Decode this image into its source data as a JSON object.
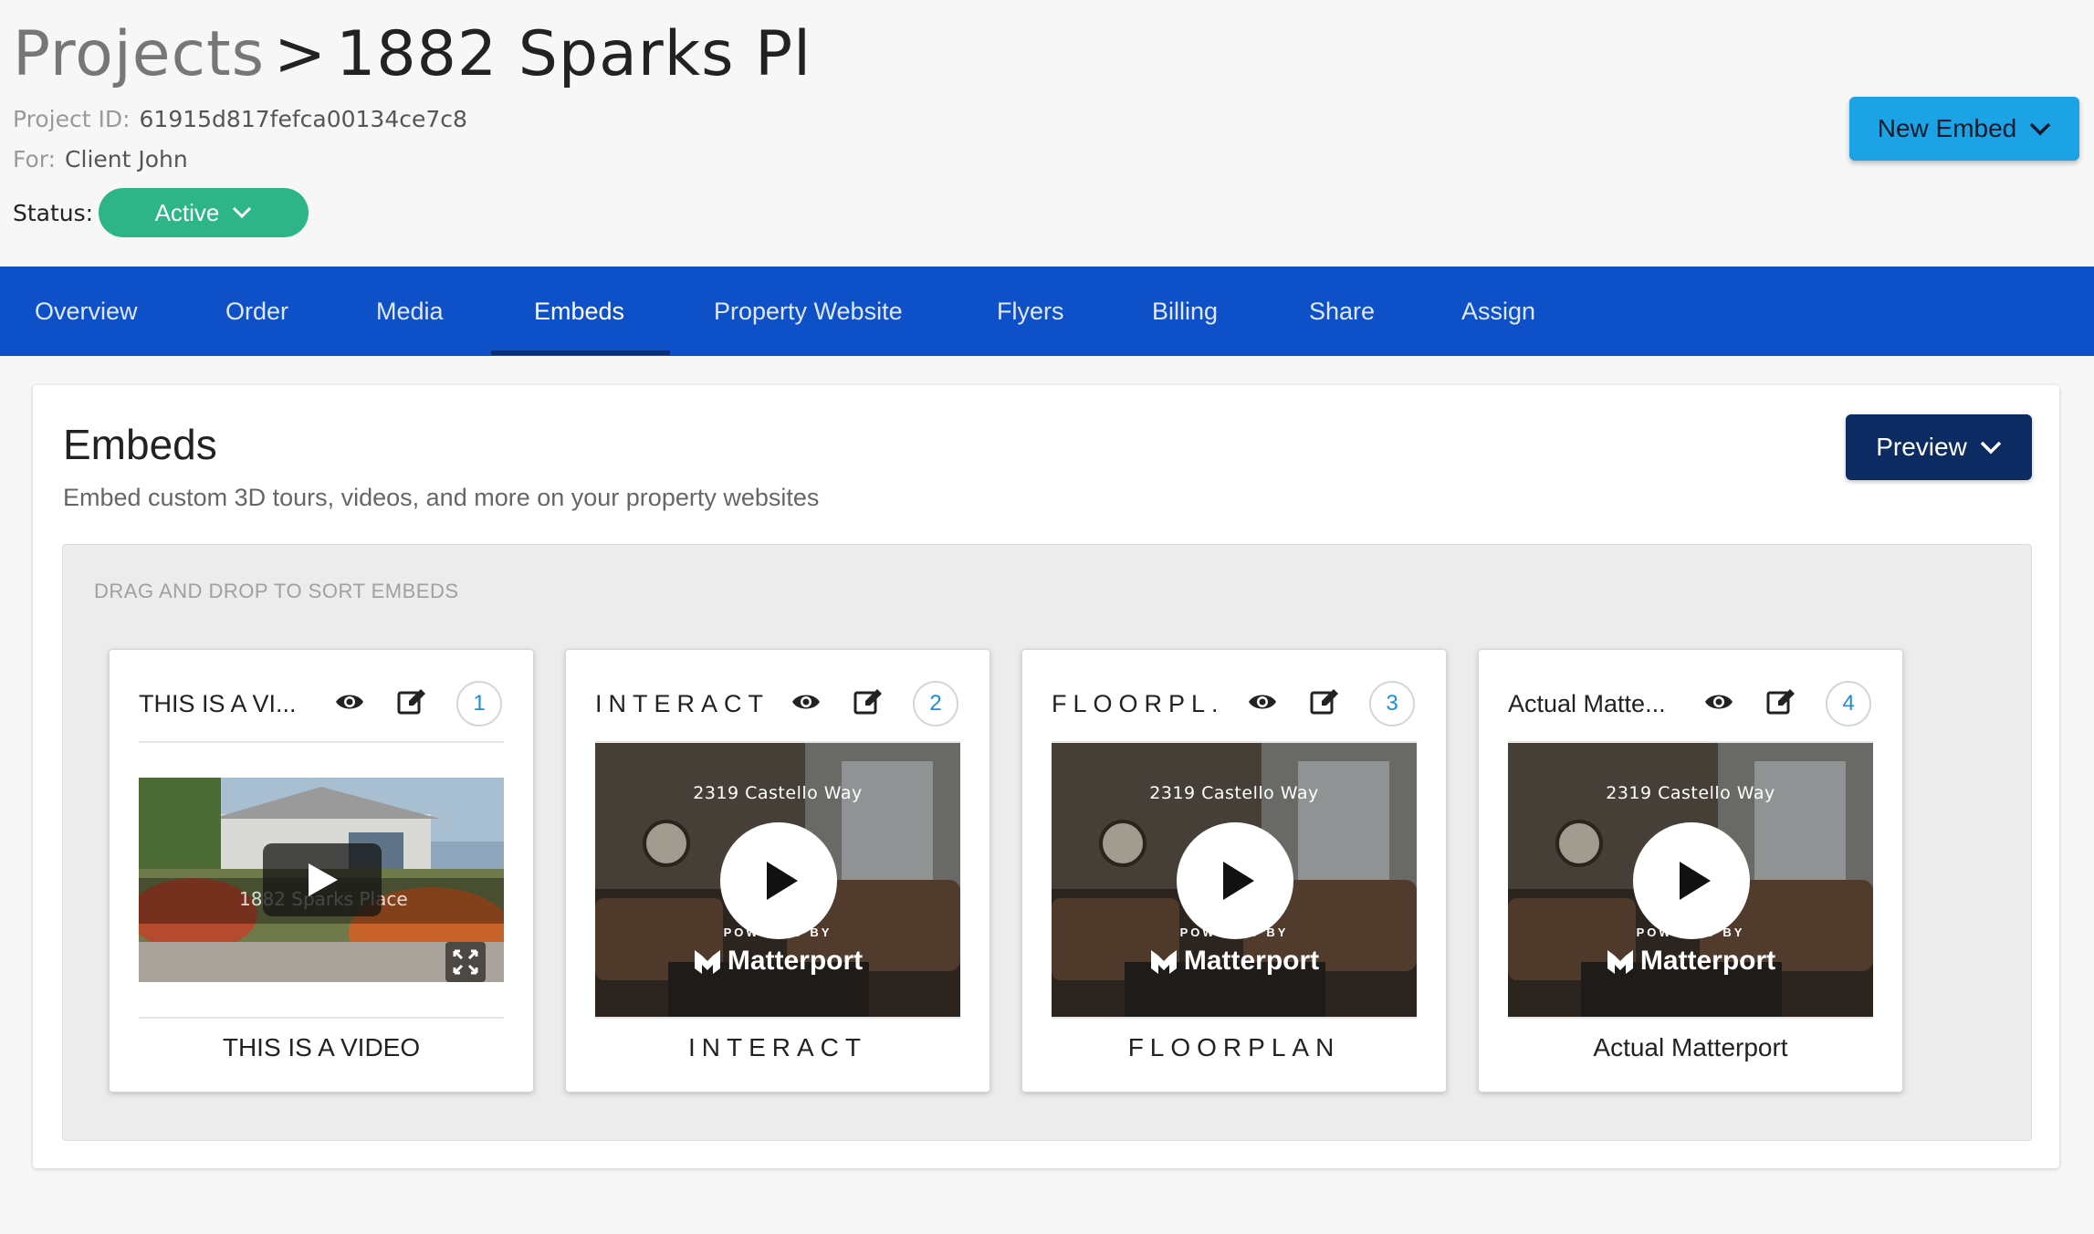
{
  "header": {
    "breadcrumb_root": "Projects",
    "breadcrumb_sep": ">",
    "project_name": "1882 Sparks Pl",
    "project_id_label": "Project ID:",
    "project_id": "61915d817fefca00134ce7c8",
    "for_label": "For:",
    "for_value": "Client John",
    "status_label": "Status:",
    "status_value": "Active",
    "new_embed_label": "New Embed"
  },
  "nav": {
    "tabs": [
      "Overview",
      "Order",
      "Media",
      "Embeds",
      "Property Website",
      "Flyers",
      "Billing",
      "Share",
      "Assign"
    ],
    "active": "Embeds"
  },
  "panel": {
    "title": "Embeds",
    "subtitle": "Embed custom 3D tours, videos, and more on your property websites",
    "preview_label": "Preview",
    "sort_label": "DRAG AND DROP TO SORT EMBEDS"
  },
  "cards": [
    {
      "title": "THIS IS A VI...",
      "number": "1",
      "caption": "THIS IS A VIDEO",
      "type": "video",
      "overlay_text": "1882 Sparks Place"
    },
    {
      "title": "INTERACT",
      "number": "2",
      "caption": "INTERACT",
      "type": "matterport",
      "address": "2319 Castello Way",
      "powered": "POWERED BY",
      "brand": "Matterport"
    },
    {
      "title": "FLOORPL...",
      "number": "3",
      "caption": "FLOORPLAN",
      "type": "matterport",
      "address": "2319 Castello Way",
      "powered": "POWERED BY",
      "brand": "Matterport"
    },
    {
      "title": "Actual Matte...",
      "number": "4",
      "caption": "Actual Matterport",
      "type": "matterport",
      "address": "2319 Castello Way",
      "powered": "POWERED BY",
      "brand": "Matterport"
    }
  ],
  "icons": {
    "status_chevron": "chevron-down-icon",
    "view": "eye-icon",
    "edit": "edit-icon",
    "play": "play-icon",
    "fullscreen": "fullscreen-icon"
  },
  "colors": {
    "nav_bg": "#0e50c8",
    "status_green": "#2db587",
    "new_embed_blue": "#1ba3e6",
    "preview_navy": "#0b2b62",
    "number_blue": "#1a8fd8"
  }
}
